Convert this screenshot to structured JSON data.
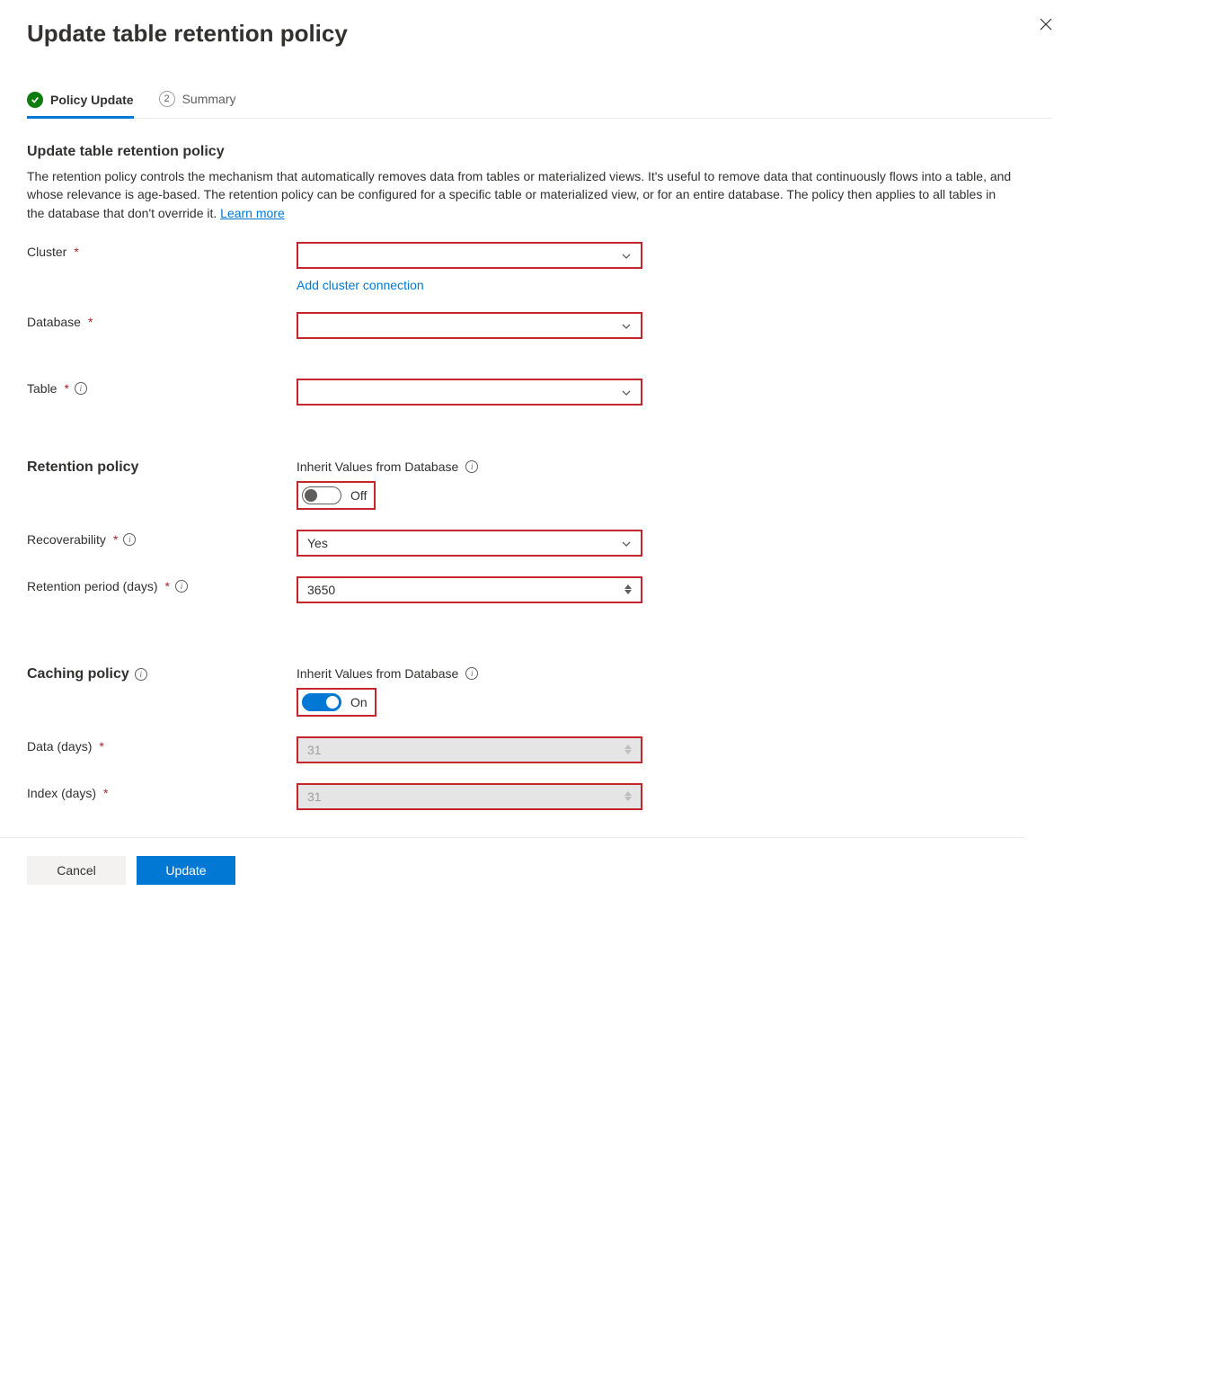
{
  "header": {
    "title": "Update table retention policy"
  },
  "tabs": {
    "policy_update": "Policy Update",
    "summary_num": "2",
    "summary": "Summary"
  },
  "intro": {
    "title": "Update table retention policy",
    "text": "The retention policy controls the mechanism that automatically removes data from tables or materialized views. It's useful to remove data that continuously flows into a table, and whose relevance is age-based. The retention policy can be configured for a specific table or materialized view, or for an entire database. The policy then applies to all tables in the database that don't override it. ",
    "learn_more": "Learn more"
  },
  "fields": {
    "cluster_label": "Cluster",
    "cluster_value": "",
    "add_cluster": "Add cluster connection",
    "database_label": "Database",
    "database_value": "",
    "table_label": "Table",
    "table_value": ""
  },
  "retention": {
    "section": "Retention policy",
    "inherit_label": "Inherit Values from Database",
    "inherit_state": "Off",
    "recoverability_label": "Recoverability",
    "recoverability_value": "Yes",
    "period_label": "Retention period (days)",
    "period_value": "3650"
  },
  "caching": {
    "section": "Caching policy",
    "inherit_label": "Inherit Values from Database",
    "inherit_state": "On",
    "data_label": "Data (days)",
    "data_value": "31",
    "index_label": "Index (days)",
    "index_value": "31"
  },
  "footer": {
    "cancel": "Cancel",
    "update": "Update"
  }
}
